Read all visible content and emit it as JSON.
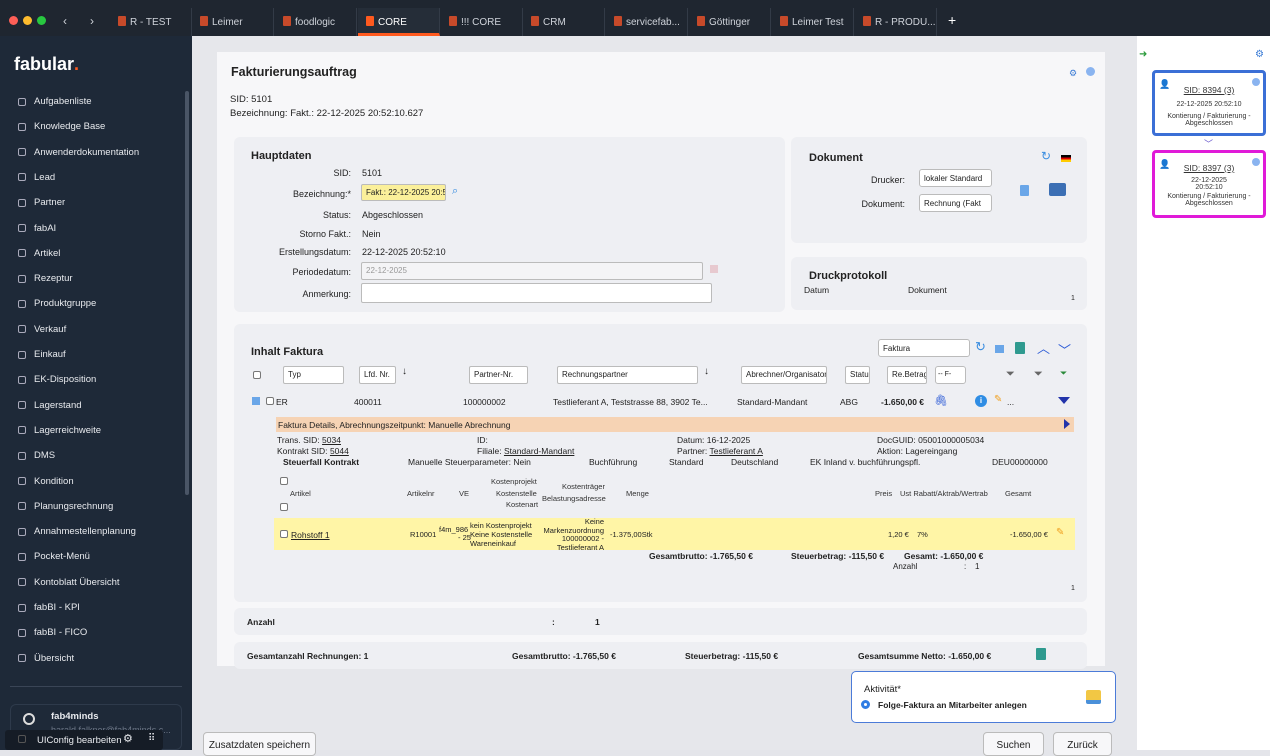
{
  "tabs": [
    "R - TEST",
    "Leimer",
    "foodlogic",
    "CORE",
    "!!! CORE",
    "CRM",
    "servicefab...",
    "Göttinger",
    "Leimer Test",
    "R - PRODU..."
  ],
  "logo": "fabular",
  "logo_dot": ".",
  "sidebar": [
    "Aufgabenliste",
    "Knowledge Base",
    "Anwenderdokumentation",
    "Lead",
    "Partner",
    "fabAI",
    "Artikel",
    "Rezeptur",
    "Produktgruppe",
    "Verkauf",
    "Einkauf",
    "EK-Disposition",
    "Lagerstand",
    "Lagerreichweite",
    "DMS",
    "Kondition",
    "Planungsrechnung",
    "Annahmestellenplanung",
    "Pocket-Menü",
    "Kontoblatt Übersicht",
    "fabBI - KPI",
    "fabBI - FICO",
    "Übersicht"
  ],
  "user": {
    "name": "fab4minds",
    "email": "harald.falkner@fab4minds.c...",
    "uiconfig": "UIConfig bearbeiten"
  },
  "page": {
    "title": "Fakturierungsauftrag",
    "sid": "SID: 5101",
    "bez": "Bezeichnung: Fakt.: 22-12-2025 20:52:10.627"
  },
  "haupt": {
    "title": "Hauptdaten",
    "sid_l": "SID:",
    "sid": "5101",
    "bez_l": "Bezeichnung:*",
    "bez": "Fakt.: 22-12-2025 20:52:10",
    "status_l": "Status:",
    "status": "Abgeschlossen",
    "storno_l": "Storno Fakt.:",
    "storno": "Nein",
    "erst_l": "Erstellungsdatum:",
    "erst": "22-12-2025 20:52:10",
    "periode_l": "Periodedatum:",
    "periode": "22-12-2025",
    "anm_l": "Anmerkung:",
    "anm": ""
  },
  "dokument": {
    "title": "Dokument",
    "drucker_l": "Drucker:",
    "drucker": "lokaler Standard",
    "dok_l": "Dokument:",
    "dok": "Rechnung (Fakt"
  },
  "druck": {
    "title": "Druckprotokoll",
    "c1": "Datum",
    "c2": "Dokument",
    "count": "1"
  },
  "inhalt": {
    "title": "Inhalt Faktura",
    "select": "Faktura",
    "filters": [
      "Typ",
      "Lfd. Nr.",
      "Partner-Nr.",
      "Rechnungspartner",
      "Abrechner/Organisator",
      "Statu",
      "Re.Betrag",
      "-- F-"
    ],
    "row": {
      "typ": "ER",
      "lfd": "400011",
      "partner": "100000002",
      "rp": "Testlieferant A, Teststrasse 88, 3902 Te...",
      "abr": "Standard-Mandant",
      "status": "ABG",
      "betrag": "-1.650,00 €",
      "more": "..."
    },
    "detail_bar": "Faktura Details, Abrechnungszeitpunkt: Manuelle Abrechnung",
    "d": {
      "trans_l": "Trans. SID:",
      "trans": "5034",
      "kontrakt_l": "Kontrakt SID:",
      "kontrakt": "5044",
      "id_l": "ID:",
      "filiale_l": "Filiale:",
      "filiale": "Standard-Mandant",
      "datum": "Datum: 16-12-2025",
      "partner_l": "Partner:",
      "partner": "Testlieferant A",
      "docguid": "DocGUID: 05001000005034",
      "aktion": "Aktion: Lagereingang",
      "steuer": "Steuerfall Kontrakt",
      "man": "Manuelle Steuerparameter: Nein",
      "buch": "Buchführung",
      "std": "Standard",
      "land": "Deutschland",
      "ek": "EK Inland v. buchführungspfl.",
      "deu": "DEU00000000"
    },
    "cols": {
      "artikel": "Artikel",
      "artnr": "Artikelnr",
      "ve": "VE",
      "kp": "Kostenprojekt",
      "ks": "Kostenstelle",
      "ka": "Kostenart",
      "kt": "Kostenträger",
      "ba": "Belastungsadresse",
      "menge": "Menge",
      "preis": "Preis",
      "ust": "Ust Rabatt/Aktrab/Wertrab",
      "gesamt": "Gesamt"
    },
    "pos": {
      "artikel": "Rohstoff 1",
      "artnr": "R10001",
      "ve1": "f4m_986",
      "ve2": "- 25",
      "k1": "kein Kostenprojekt",
      "k2": "Keine Kostenstelle",
      "k3": "Wareneinkauf",
      "t1": "Keine",
      "t2": "Markenzuordnung",
      "t3": "100000002 -",
      "t4": "Testlieferant A",
      "menge": "-1.375,00Stk",
      "preis": "1,20 €",
      "ust": "7%",
      "gesamt": "-1.650,00 €"
    },
    "sum": {
      "brutto": "Gesamtbrutto: -1.765,50 €",
      "steuer": "Steuerbetrag: -115,50 €",
      "gesamt": "Gesamt: -1.650,00 €",
      "anzahl_l": "Anzahl",
      "colon": ":",
      "anzahl": "1"
    },
    "page": "1"
  },
  "anzahl": {
    "l": "Anzahl",
    "c": ":",
    "v": "1"
  },
  "totals": {
    "count": "Gesamtanzahl Rechnungen: 1",
    "brutto": "Gesamtbrutto: -1.765,50 €",
    "steuer": "Steuerbetrag: -115,50 €",
    "netto": "Gesamtsumme Netto: -1.650,00 €"
  },
  "aktiv": {
    "title": "Aktivität*",
    "option": "Folge-Faktura an Mitarbeiter anlegen"
  },
  "buttons": {
    "zusatz": "Zusatzdaten speichern",
    "suchen": "Suchen",
    "zurueck": "Zurück"
  },
  "workflow": [
    {
      "sid": "SID: 8394 (3)",
      "date": "22-12-2025 20:52:10",
      "status": "Kontierung / Fakturierung - Abgeschlossen",
      "color": "#3b6fd6"
    },
    {
      "sid": "SID: 8397 (3)",
      "date": "22-12-2025 20:52:10",
      "status": "Kontierung / Fakturierung - Abgeschlossen",
      "color": "#e01ad8"
    }
  ]
}
